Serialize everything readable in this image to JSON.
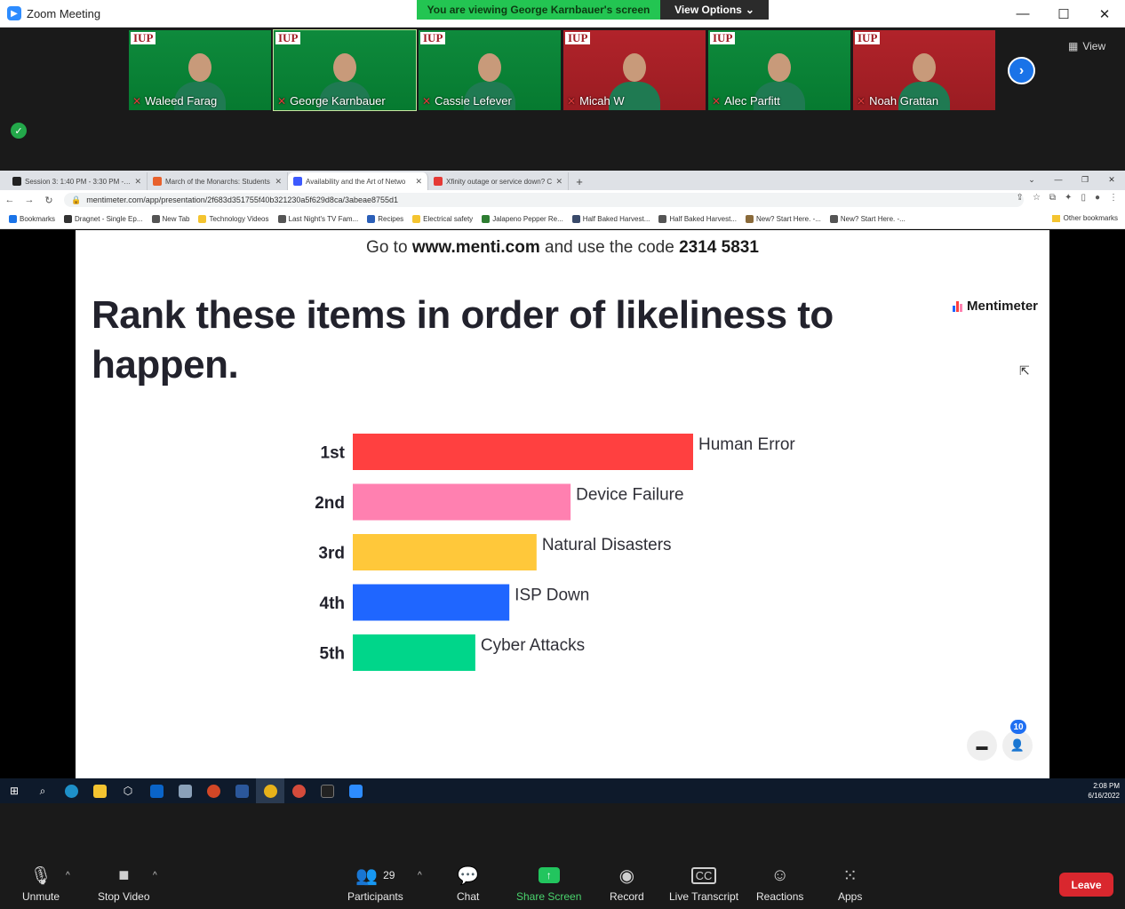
{
  "window": {
    "title": "Zoom Meeting",
    "minimize": "—",
    "maximize": "☐",
    "close": "✕"
  },
  "banner": {
    "viewing": "You are viewing George Karnbauer's screen",
    "view_options": "View Options",
    "view_options_caret": "⌄"
  },
  "view_button": {
    "label": "View"
  },
  "participants_strip": [
    {
      "name": "Waleed Farag",
      "bg": "green"
    },
    {
      "name": "George Karnbauer",
      "bg": "green"
    },
    {
      "name": "Cassie Lefever",
      "bg": "green"
    },
    {
      "name": "Micah W",
      "bg": "red"
    },
    {
      "name": "Alec Parfitt",
      "bg": "green"
    },
    {
      "name": "Noah Grattan",
      "bg": "red"
    }
  ],
  "tile_logo": "IUP",
  "browser": {
    "tabs": [
      {
        "label": "Session 3: 1:40 PM - 3:30 PM - M",
        "color": "#222222"
      },
      {
        "label": "March of the Monarchs: Students",
        "color": "#e8612c"
      },
      {
        "label": "Availability and the Art of Netwo",
        "color": "#3d5afe"
      },
      {
        "label": "Xfinity outage or service down? C",
        "color": "#e53935"
      }
    ],
    "new_tab": "+",
    "url": "mentimeter.com/app/presentation/2f683d351755f40b321230a5f629d8ca/3abeae8755d1",
    "bookmarks": [
      {
        "label": "Bookmarks",
        "color": "#1a73e8"
      },
      {
        "label": "Dragnet - Single Ep...",
        "color": "#333333"
      },
      {
        "label": "New Tab",
        "color": "#555555"
      },
      {
        "label": "Technology Videos",
        "color": "#f4c430"
      },
      {
        "label": "Last Night's TV Fam...",
        "color": "#555555"
      },
      {
        "label": "Recipes",
        "color": "#2b5fb8"
      },
      {
        "label": "Electrical safety",
        "color": "#f4c430"
      },
      {
        "label": "Jalapeno Pepper Re...",
        "color": "#2e7d32"
      },
      {
        "label": "Half Baked Harvest...",
        "color": "#3a4a6a"
      },
      {
        "label": "Half Baked Harvest...",
        "color": "#555555"
      },
      {
        "label": "New? Start Here. -...",
        "color": "#8a6a3a"
      },
      {
        "label": "New? Start Here. -...",
        "color": "#555555"
      }
    ],
    "other_bookmarks": "Other bookmarks"
  },
  "slide": {
    "code_prefix": "Go to",
    "code_site": "www.menti.com",
    "code_middle": "and use the code",
    "code_value": "2314 5831",
    "brand": "Mentimeter",
    "question": "Rank these items in order of likeliness to happen.",
    "badge_count": "10"
  },
  "chart_data": {
    "type": "bar",
    "orientation": "horizontal",
    "categories": [
      "1st",
      "2nd",
      "3rd",
      "4th",
      "5th"
    ],
    "labels": [
      "Human Error",
      "Device Failure",
      "Natural Disasters",
      "ISP Down",
      "Cyber Attacks"
    ],
    "values": [
      100,
      64,
      54,
      46,
      36
    ],
    "colors": [
      "#ff4040",
      "#ff80b0",
      "#ffc83a",
      "#1f66ff",
      "#00d68a"
    ]
  },
  "taskbar": {
    "time": "2:08 PM",
    "date": "6/16/2022"
  },
  "controls": {
    "unmute": "Unmute",
    "stop_video": "Stop Video",
    "participants": "Participants",
    "participants_count": "29",
    "chat": "Chat",
    "share_screen": "Share Screen",
    "record": "Record",
    "live_transcript": "Live Transcript",
    "reactions": "Reactions",
    "apps": "Apps",
    "leave": "Leave"
  },
  "colors": {
    "zoom_blue": "#2d8cff",
    "banner_green": "#23c552",
    "leave_red": "#d9272e"
  }
}
